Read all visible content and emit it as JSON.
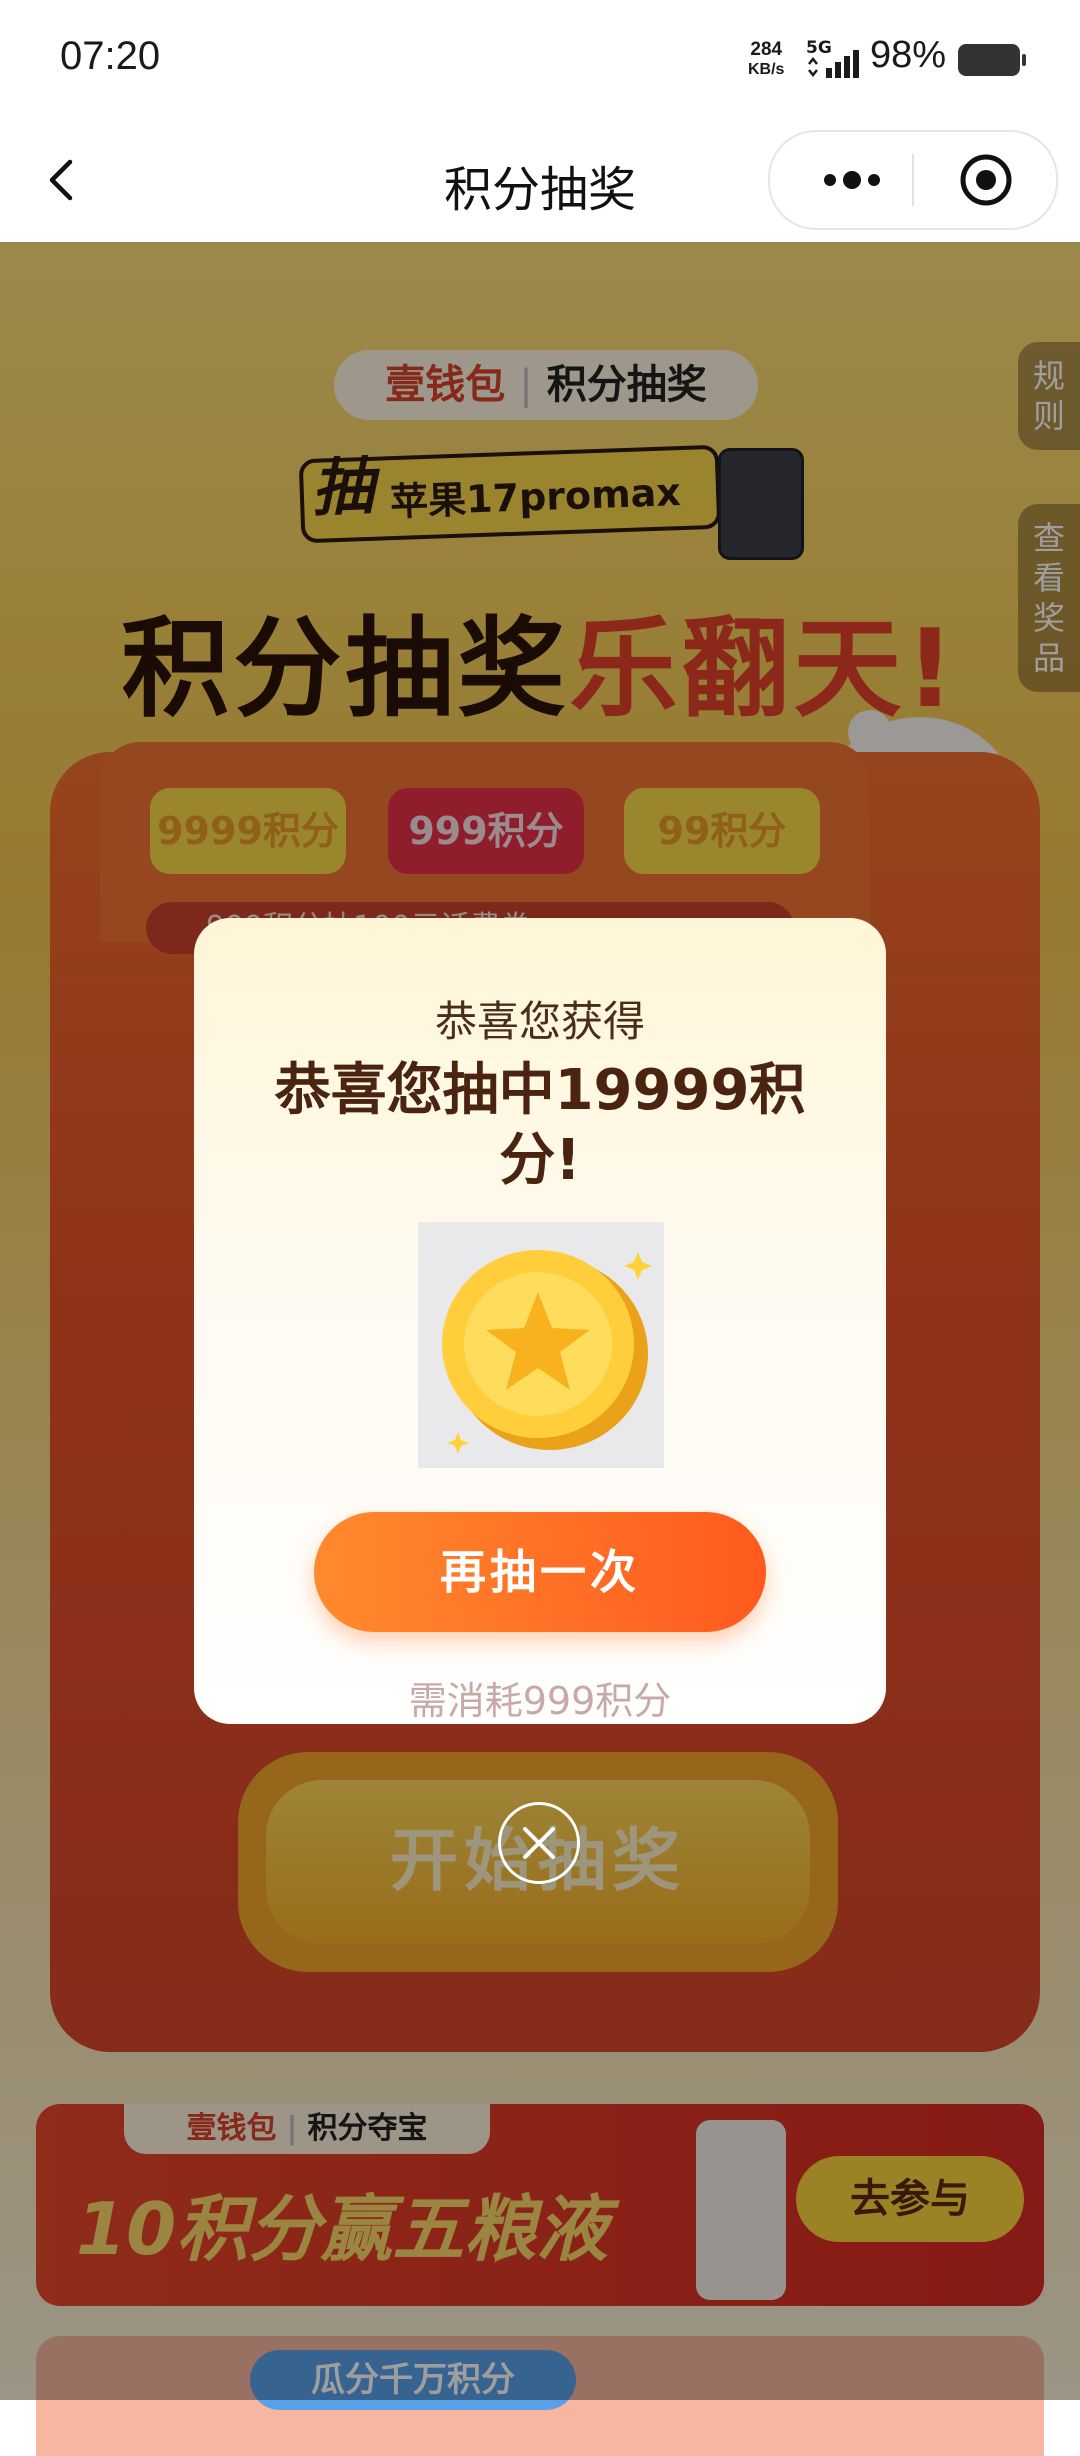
{
  "status_bar": {
    "time": "07:20",
    "net_speed_value": "284",
    "net_speed_unit": "KB/s",
    "network": "5G",
    "battery": "98%"
  },
  "nav": {
    "title": "积分抽奖",
    "back_icon": "chevron-left-icon",
    "more_icon": "more-dots-icon",
    "target_icon": "target-circle-icon"
  },
  "background": {
    "brand_left": "壹钱包",
    "brand_right": "积分抽奖",
    "promo_prefix": "抽",
    "promo_text": "苹果17promax",
    "headline_part1": "积分抽奖",
    "headline_part2": "乐翻天!",
    "side_rules": "规则",
    "side_prizes": "查看奖品",
    "tier_a": "9999积分",
    "tier_b": "999积分",
    "tier_c": "99积分",
    "ticker": "999积分抽100元话费券",
    "start_button": "开始抽奖",
    "banner1_brand_left": "壹钱包",
    "banner1_brand_right": "积分夺宝",
    "banner1_slogan": "10积分赢五粮液",
    "banner1_join": "去参与",
    "banner2_label": "瓜分千万积分"
  },
  "modal": {
    "subtitle": "恭喜您获得",
    "title": "恭喜您抽中19999积分!",
    "image_icon": "gold-star-coin-icon",
    "again_button": "再抽一次",
    "cost_note": "需消耗999积分",
    "close_icon": "close-circle-icon"
  },
  "colors": {
    "accent_orange": "#ff6a24",
    "title_brown": "#4a2410",
    "overlay": "rgba(0,0,0,0.38)"
  }
}
